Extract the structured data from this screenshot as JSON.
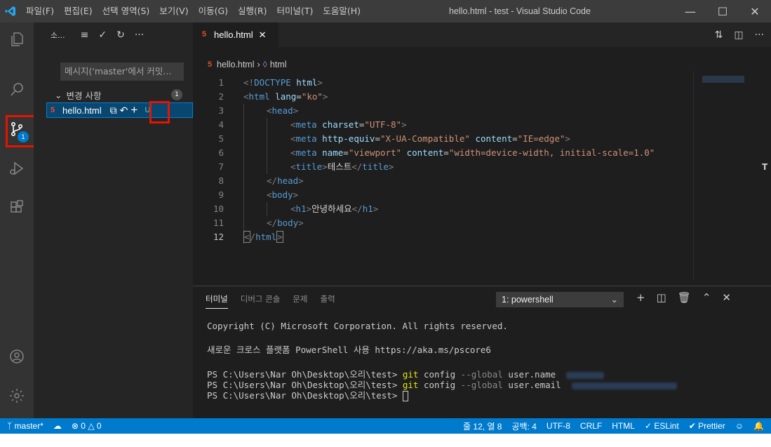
{
  "titlebar": {
    "menu": [
      "파일(F)",
      "편집(E)",
      "선택 영역(S)",
      "보기(V)",
      "이동(G)",
      "실행(R)",
      "터미널(T)",
      "도움말(H)"
    ],
    "window_title": "hello.html - test - Visual Studio Code",
    "controls": [
      "minimize-icon",
      "maximize-icon",
      "close-icon"
    ]
  },
  "activity_bar": {
    "items": [
      "explorer-icon",
      "search-icon",
      "source-control-icon",
      "run-debug-icon",
      "extensions-icon"
    ],
    "source_control_badge": "1",
    "bottom": [
      "account-icon",
      "settings-gear-icon"
    ]
  },
  "sidebar": {
    "title": "소...",
    "commit_placeholder": "메시지('master'에서 커밋...",
    "changes_label": "변경 사항",
    "changes_count": "1",
    "file_name": "hello.html",
    "file_status": "U"
  },
  "editor": {
    "tab_label": "hello.html",
    "breadcrumb_file": "hello.html",
    "breadcrumb_symbol": "html",
    "active_line": 12
  },
  "panel": {
    "tabs": [
      "터미널",
      "디버그 콘솔",
      "문제",
      "출력"
    ],
    "shell_select": "1: powershell",
    "lines": {
      "copyright": "Copyright (C) Microsoft Corporation. All rights reserved.",
      "pscore": "새로운 크로스 플랫폼 PowerShell 사용 https://aka.ms/pscore6",
      "prompt": "PS C:\\Users\\Nar Oh\\Desktop\\오리\\test> ",
      "cmd1_git": "git",
      "cmd1_config": " config ",
      "cmd1_flag": "--global",
      "cmd1_key": " user.name",
      "cmd2_key": " user.email"
    }
  },
  "statusbar": {
    "branch": "master*",
    "errors": "0",
    "warnings": "0",
    "position": "줄 12, 열 8",
    "spaces": "공백: 4",
    "encoding": "UTF-8",
    "eol": "CRLF",
    "language": "HTML",
    "eslint": "ESLint",
    "prettier": "Prettier"
  },
  "colors": {
    "accent": "#007acc",
    "highlight_box": "#e51400"
  }
}
